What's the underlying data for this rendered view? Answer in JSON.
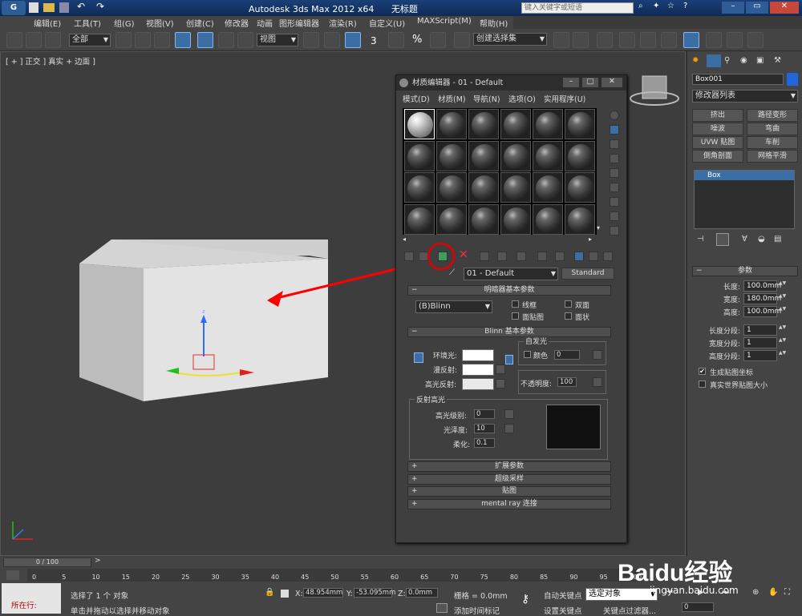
{
  "titlebar": {
    "app_title": "Autodesk 3ds Max  2012 x64",
    "doc_name": "无标题",
    "search_placeholder": "键入关键字或短语"
  },
  "menu": [
    "编辑(E)",
    "工具(T)",
    "组(G)",
    "视图(V)",
    "创建(C)",
    "修改器",
    "动画",
    "图形编辑器",
    "渲染(R)",
    "自定义(U)",
    "MAXScript(M)",
    "帮助(H)"
  ],
  "toolbar": {
    "selection_filter": "全部",
    "ref_coord": "视图",
    "named_selection": "创建选择集",
    "snap_label": "3",
    "percent_label": "%"
  },
  "viewport": {
    "label": "[ + ] 正交 ] 真实 + 边面 ]",
    "colors": {
      "background": "#3d3d3d",
      "box_front": "#e3e3e3",
      "box_top": "#cfcfcf",
      "box_side": "#bcbcbc",
      "arrow": "#ff0000"
    }
  },
  "command_panel": {
    "object_name": "Box001",
    "object_color": "#2266dd",
    "modifier_list": "修改器列表",
    "buttons": [
      "挤出",
      "路径变形",
      "噪波",
      "弯曲",
      "UVW 贴图",
      "车削",
      "倒角剖面",
      "网格平滑"
    ],
    "stack_item": "Box",
    "params_title": "参数",
    "params": [
      {
        "label": "长度:",
        "value": "100.0mm"
      },
      {
        "label": "宽度:",
        "value": "180.0mm"
      },
      {
        "label": "高度:",
        "value": "100.0mm"
      },
      {
        "label": "长度分段:",
        "value": "1"
      },
      {
        "label": "宽度分段:",
        "value": "1"
      },
      {
        "label": "高度分段:",
        "value": "1"
      }
    ],
    "gen_mapping": "生成贴图坐标",
    "real_world": "真实世界贴图大小"
  },
  "material_editor": {
    "title": "材质编辑器 - 01 - Default",
    "menu": [
      "模式(D)",
      "材质(M)",
      "导航(N)",
      "选项(O)",
      "实用程序(U)"
    ],
    "material_name": "01 - Default",
    "material_type": "Standard",
    "shader_rollout": "明暗器基本参数",
    "shader": "(B)Blinn",
    "shader_checks": [
      "线框",
      "双面",
      "面贴图",
      "面状"
    ],
    "blinn_rollout": "Blinn 基本参数",
    "self_illum": "自发光",
    "color_label": "颜色",
    "self_illum_value": "0",
    "ambient": "环境光:",
    "diffuse": "漫反射:",
    "specular": "高光反射:",
    "opacity_label": "不透明度:",
    "opacity_value": "100",
    "spec_highlights": "反射高光",
    "spec_level_label": "高光级别:",
    "spec_level": "0",
    "gloss_label": "光泽度:",
    "gloss": "10",
    "soften_label": "柔化:",
    "soften": "0.1",
    "rollouts": [
      "扩展参数",
      "超级采样",
      "贴图",
      "mental ray 连接"
    ],
    "rollout_expand": "+"
  },
  "timeline": {
    "frame": "0 / 100",
    "ticks": [
      "0",
      "5",
      "10",
      "15",
      "20",
      "25",
      "30",
      "35",
      "40",
      "45",
      "50",
      "55",
      "60",
      "65",
      "70",
      "75",
      "80",
      "85",
      "90",
      "95",
      "100"
    ]
  },
  "statusbar": {
    "running": "所在行:",
    "selected": "选择了 1 个 对象",
    "prompt": "单击并拖动以选择并移动对象",
    "x_label": "X:",
    "x": "48.954mm",
    "y_label": "Y:",
    "y": "-53.095mm",
    "z_label": "Z:",
    "z": "0.0mm",
    "grid": "栅格 = 0.0mm",
    "add_time_tag": "添加时间标记",
    "auto_key": "自动关键点",
    "set_key": "设置关键点",
    "selected_obj": "选定对象",
    "key_filters": "关键点过滤器...",
    "frame_field": "0"
  },
  "watermark": {
    "logo": "Baidu经验",
    "url": "jingyan.baidu.com"
  }
}
